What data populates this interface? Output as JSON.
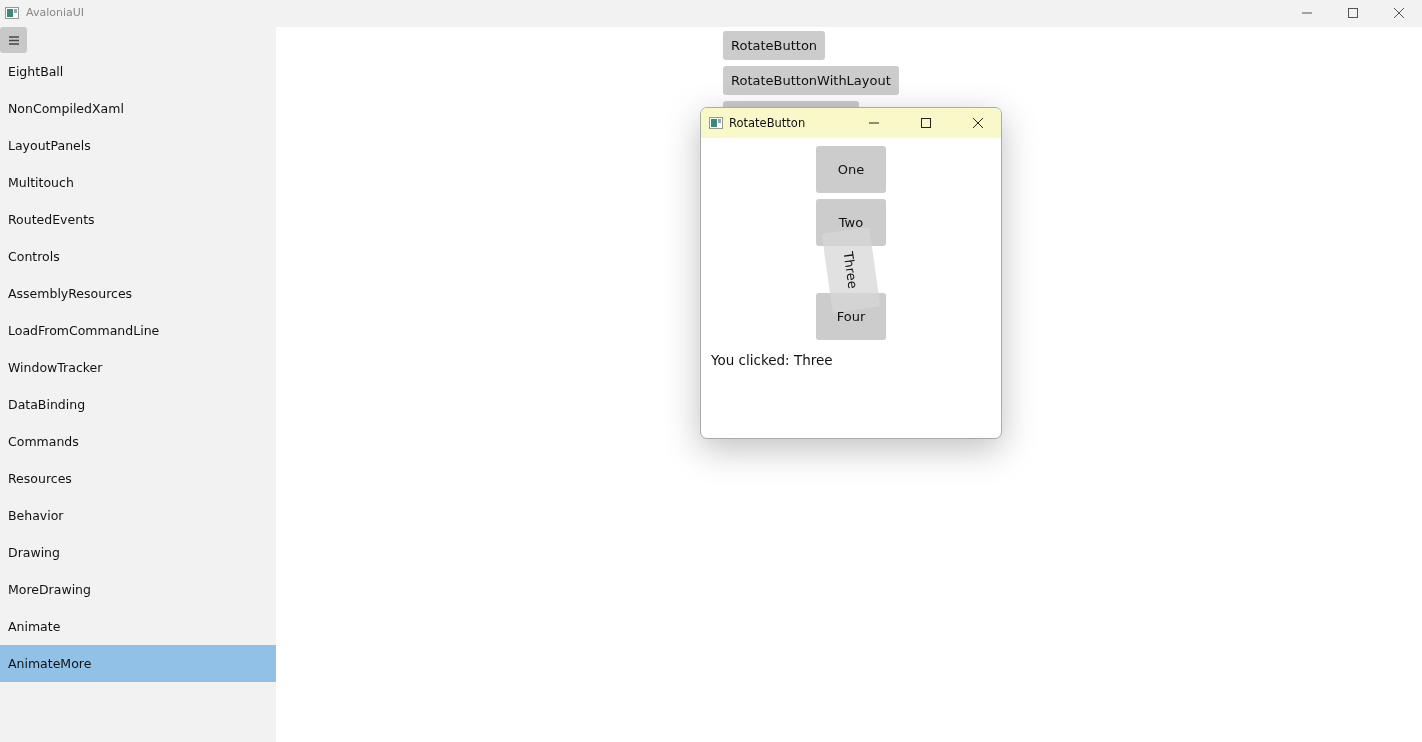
{
  "window": {
    "title": "AvaloniaUI"
  },
  "sidebar": {
    "items": [
      {
        "label": "EightBall",
        "selected": false
      },
      {
        "label": "NonCompiledXaml",
        "selected": false
      },
      {
        "label": "LayoutPanels",
        "selected": false
      },
      {
        "label": "Multitouch",
        "selected": false
      },
      {
        "label": "RoutedEvents",
        "selected": false
      },
      {
        "label": "Controls",
        "selected": false
      },
      {
        "label": "AssemblyResources",
        "selected": false
      },
      {
        "label": "LoadFromCommandLine",
        "selected": false
      },
      {
        "label": "WindowTracker",
        "selected": false
      },
      {
        "label": "DataBinding",
        "selected": false
      },
      {
        "label": "Commands",
        "selected": false
      },
      {
        "label": "Resources",
        "selected": false
      },
      {
        "label": "Behavior",
        "selected": false
      },
      {
        "label": "Drawing",
        "selected": false
      },
      {
        "label": "MoreDrawing",
        "selected": false
      },
      {
        "label": "Animate",
        "selected": false
      },
      {
        "label": "AnimateMore",
        "selected": true
      }
    ]
  },
  "main": {
    "buttons": [
      "RotateButton",
      "RotateButtonWithLayout"
    ]
  },
  "dialog": {
    "title": "RotateButton",
    "buttons": [
      {
        "label": "One",
        "rotated": false
      },
      {
        "label": "Two",
        "rotated": false
      },
      {
        "label": "Three",
        "rotated": true
      },
      {
        "label": "Four",
        "rotated": false
      }
    ],
    "message": "You clicked: Three"
  }
}
